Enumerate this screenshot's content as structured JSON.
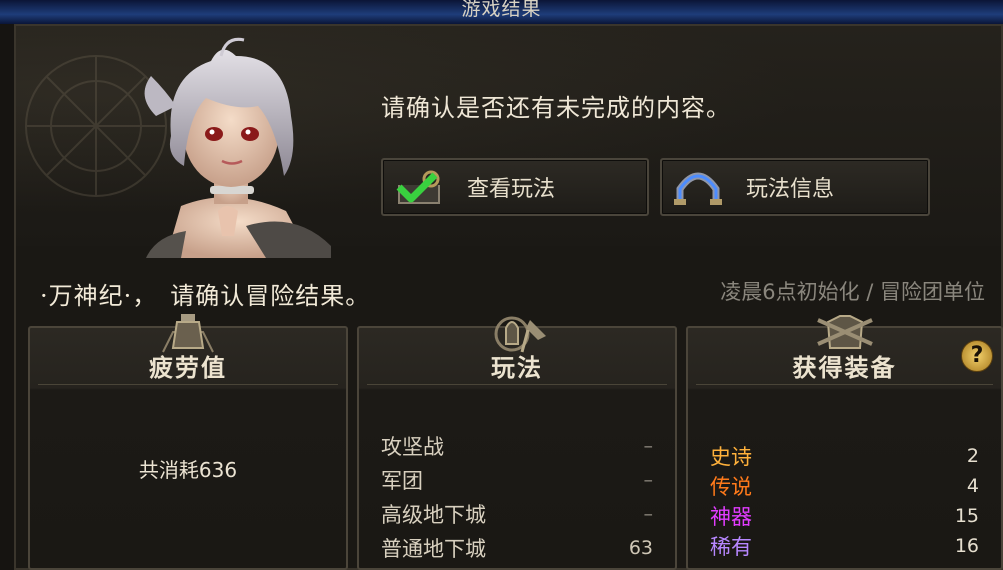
{
  "window": {
    "title": "游戏结果"
  },
  "prompt": {
    "text": "请确认是否还有未完成的内容。",
    "buttons": [
      {
        "label": "查看玩法",
        "icon": "check-icon"
      },
      {
        "label": "玩法信息",
        "icon": "arch-icon"
      }
    ]
  },
  "adventure": {
    "confirm_text": "·万神纪·，　请确认冒险结果。",
    "reset_text": "凌晨6点初始化 / 冒险团单位"
  },
  "fatigue_card": {
    "title": "疲劳值",
    "consumed_text": "共消耗636"
  },
  "play_card": {
    "title": "玩法",
    "rows": [
      {
        "name": "攻坚战",
        "value": "–"
      },
      {
        "name": "军团",
        "value": "–"
      },
      {
        "name": "高级地下城",
        "value": "–"
      },
      {
        "name": "普通地下城",
        "value": "63"
      }
    ]
  },
  "loot_card": {
    "title": "获得装备",
    "help": "?",
    "rows": [
      {
        "name": "史诗",
        "value": "2",
        "color": "#ffb13b"
      },
      {
        "name": "传说",
        "value": "4",
        "color": "#ff7a1a"
      },
      {
        "name": "神器",
        "value": "15",
        "color": "#e23cff"
      },
      {
        "name": "稀有",
        "value": "16",
        "color": "#b787ff"
      }
    ]
  }
}
